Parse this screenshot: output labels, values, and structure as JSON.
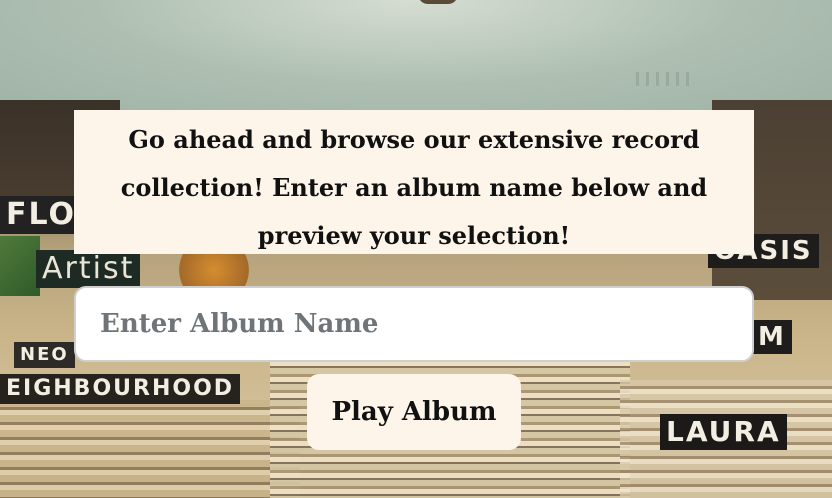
{
  "intro": {
    "text": "Go ahead and browse our extensive record collection! Enter an album name below and preview your selection!"
  },
  "search": {
    "placeholder": "Enter Album Name",
    "value": ""
  },
  "actions": {
    "play_label": "Play Album"
  },
  "background": {
    "sign_texts": [
      "FLO",
      "Artist",
      "NEO",
      "EIGHBOURHOOD",
      "OASIS",
      "M",
      "LAURA"
    ]
  },
  "colors": {
    "panel": "#fdf5ea",
    "text": "#111111",
    "placeholder": "#6e7478"
  }
}
